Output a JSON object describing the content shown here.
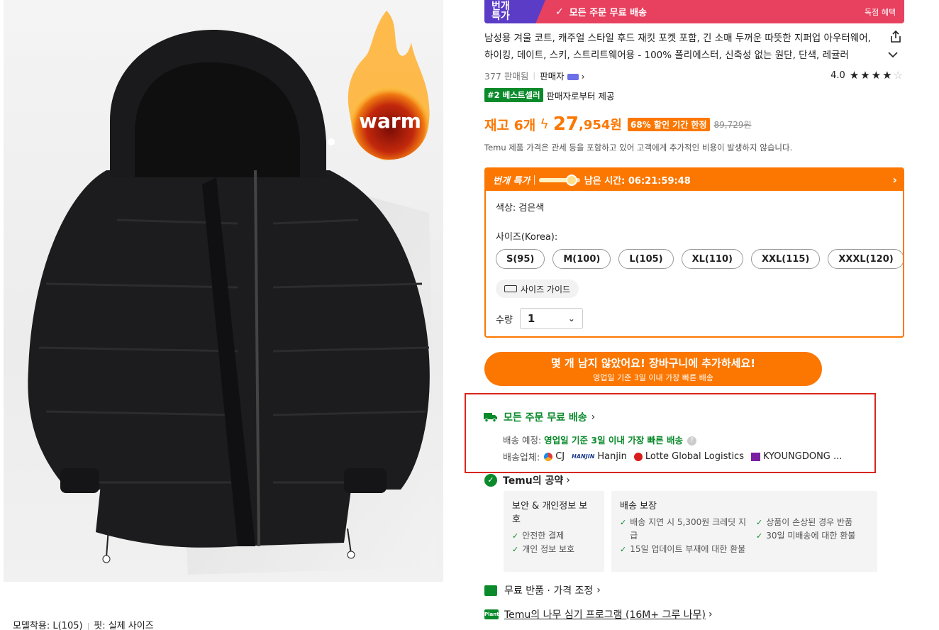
{
  "image": {
    "warm_badge": "warm",
    "caption": {
      "model": "모델착용: L(105)",
      "fit": "핏: 실제 사이즈"
    }
  },
  "banner": {
    "badge": "번개 특가",
    "free_shipping": "모든 주문 무료 배송",
    "exclusive": "독점 혜택"
  },
  "product": {
    "title": "남성용 겨울 코트, 캐주얼 스타일 후드 재킷 포켓 포함, 긴 소매 두꺼운 따뜻한 지퍼업 아우터웨어, 하이킹, 데이트, 스키, 스트리트웨어용 - 100% 폴리에스터, 신축성 없는 원단, 단색, 레귤러",
    "sold": "377 판매됨",
    "seller_label": "판매자",
    "rating": "4.0",
    "rating_value": 4,
    "bestseller_badge": "#2 베스트셀러",
    "bestseller_from": "판매자로부터 제공"
  },
  "price": {
    "stock": "재고 6개",
    "big": "27",
    "small": ",954원",
    "discount": "68% 할인 기간 한정",
    "original": "89,729원",
    "tax_note": "Temu 제품 가격은 관세 등을 포함하고 있어 고객에게 추가적인 비용이 발생하지 않습니다."
  },
  "deal": {
    "label": "번개 특가",
    "timer_text": "남은 시간: 06:21:59:48",
    "color_line": "색상: 검은색",
    "size_label": "사이즈(Korea):",
    "sizes": [
      "S(95)",
      "M(100)",
      "L(105)",
      "XL(110)",
      "XXL(115)",
      "XXXL(120)"
    ],
    "size_guide": "사이즈 가이드",
    "qty_label": "수량",
    "qty_value": "1"
  },
  "cart": {
    "main": "몇 개 남지 않았어요! 장바구니에 추가하세요!",
    "sub": "영업일 기준 3일 이내 가장 빠른 배송"
  },
  "shipping": {
    "title": "모든 주문 무료 배송",
    "eta_label": "배송 예정:",
    "eta_value": "영업일 기준 3일 이내 가장 빠른 배송",
    "carrier_label": "배송업체:",
    "carriers": {
      "cj": "CJ",
      "hanjin_logo": "HANJIN",
      "hanjin": "Hanjin",
      "lotte": "Lotte Global Logistics",
      "kd": "KYOUNGDONG ..."
    }
  },
  "promise": {
    "title": "Temu의 공약",
    "security": {
      "header": "보안 & 개인정보 보호",
      "items": [
        "안전한 결제",
        "개인 정보 보호"
      ]
    },
    "delivery": {
      "header": "배송 보장",
      "items_left": [
        "배송 지연 시 5,300원 크레딧 지급",
        "15일 업데이트 부재에 대한 환불"
      ],
      "items_right": [
        "상품이 손상된 경우 반품",
        "30일 미배송에 대한 환불"
      ]
    }
  },
  "links": {
    "returns": "무료 반품 · 가격 조정",
    "plant_badge": "Plant",
    "tree": "Temu의 나무 심기 프로그램 (16M+ 그루 나무)"
  },
  "colors": {
    "accent_orange": "#fb7701",
    "banner_red": "#e8405f",
    "banner_purple": "#5a3cc6",
    "green": "#0a8a2b",
    "highlight_red": "#d9261c"
  }
}
